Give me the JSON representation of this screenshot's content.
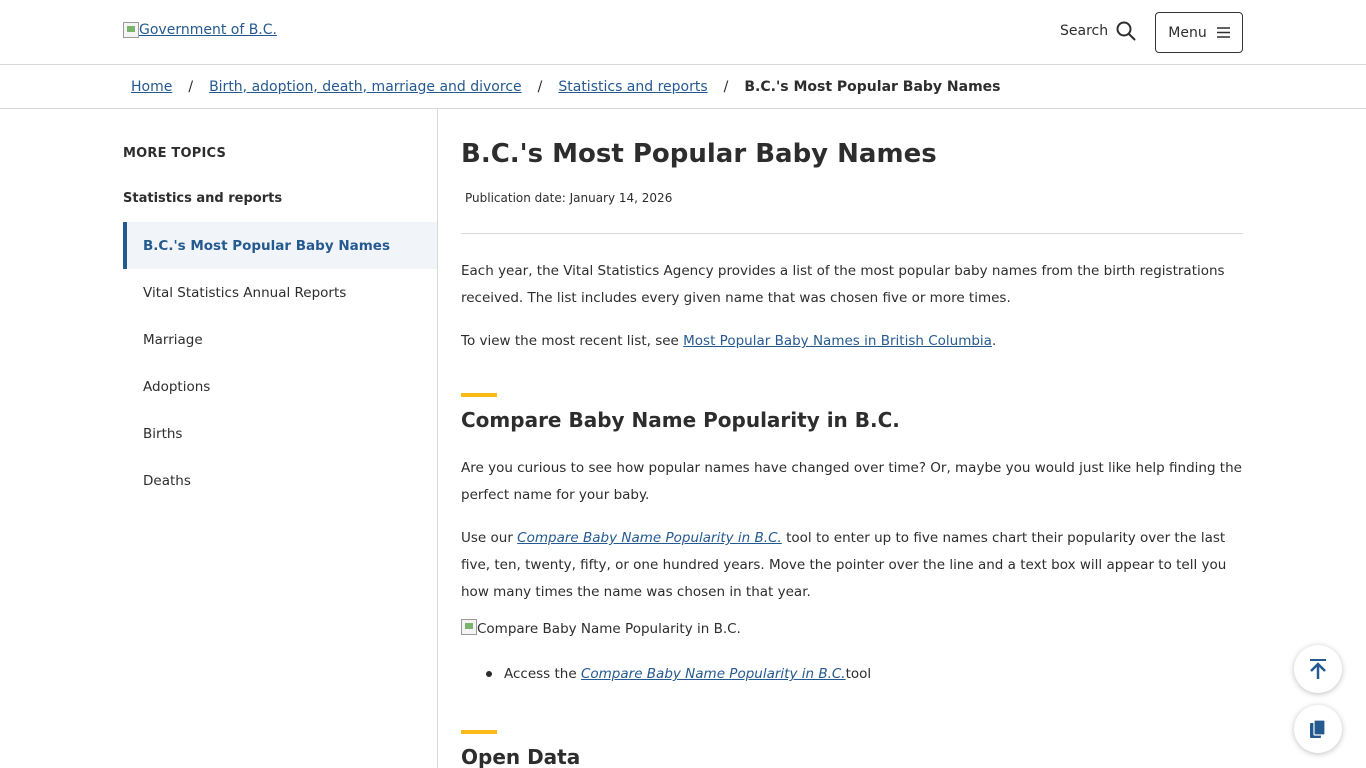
{
  "header": {
    "logo_alt": "Government of B.C.",
    "search_label": "Search",
    "menu_label": "Menu"
  },
  "breadcrumb": {
    "items": [
      "Home",
      "Birth, adoption, death, marriage and divorce",
      "Statistics and reports"
    ],
    "separator": "/",
    "current": "B.C.'s Most Popular Baby Names"
  },
  "sidebar": {
    "more_topics": "MORE TOPICS",
    "section_title": "Statistics and reports",
    "items": [
      {
        "label": "B.C.'s Most Popular Baby Names",
        "active": true
      },
      {
        "label": "Vital Statistics Annual Reports"
      },
      {
        "label": "Marriage"
      },
      {
        "label": "Adoptions"
      },
      {
        "label": "Births"
      },
      {
        "label": "Deaths"
      }
    ]
  },
  "main": {
    "title": "B.C.'s Most Popular Baby Names",
    "publication_date": "Publication date: January 14, 2026",
    "intro_p1": "Each year, the Vital Statistics Agency provides a list of the most popular baby names from the birth registrations received. The list includes every given name that was chosen five or more times.",
    "intro_p2_prefix": "To view the most recent list, see ",
    "intro_p2_link": "Most Popular Baby Names in British Columbia",
    "intro_p2_suffix": ".",
    "section1_title": "Compare Baby Name Popularity in B.C.",
    "section1_p1": "Are you curious to see how popular names have changed over time? Or, maybe you would just like help finding the perfect name for your baby.",
    "section1_p2_prefix": "Use our ",
    "section1_p2_link": "Compare Baby Name Popularity in B.C.",
    "section1_p2_suffix": " tool to enter up to five names chart their popularity over the last five, ten, twenty, fifty, or one hundred years. Move the pointer over the line and a text box will appear to tell you how many times the name was chosen in that year.",
    "image_alt": "Compare Baby Name Popularity in B.C.",
    "bullet_prefix": "Access the ",
    "bullet_link": "Compare Baby Name Popularity in B.C.",
    "bullet_suffix": " tool",
    "section2_title": "Open Data"
  },
  "colors": {
    "link": "#255a90",
    "accent": "#fcba19",
    "text": "#2d2d2d",
    "border": "#d8d8d8"
  },
  "icons": {
    "search": "search-icon",
    "menu": "hamburger-icon",
    "back_to_top": "arrow-up-icon",
    "copy": "copy-icon"
  }
}
